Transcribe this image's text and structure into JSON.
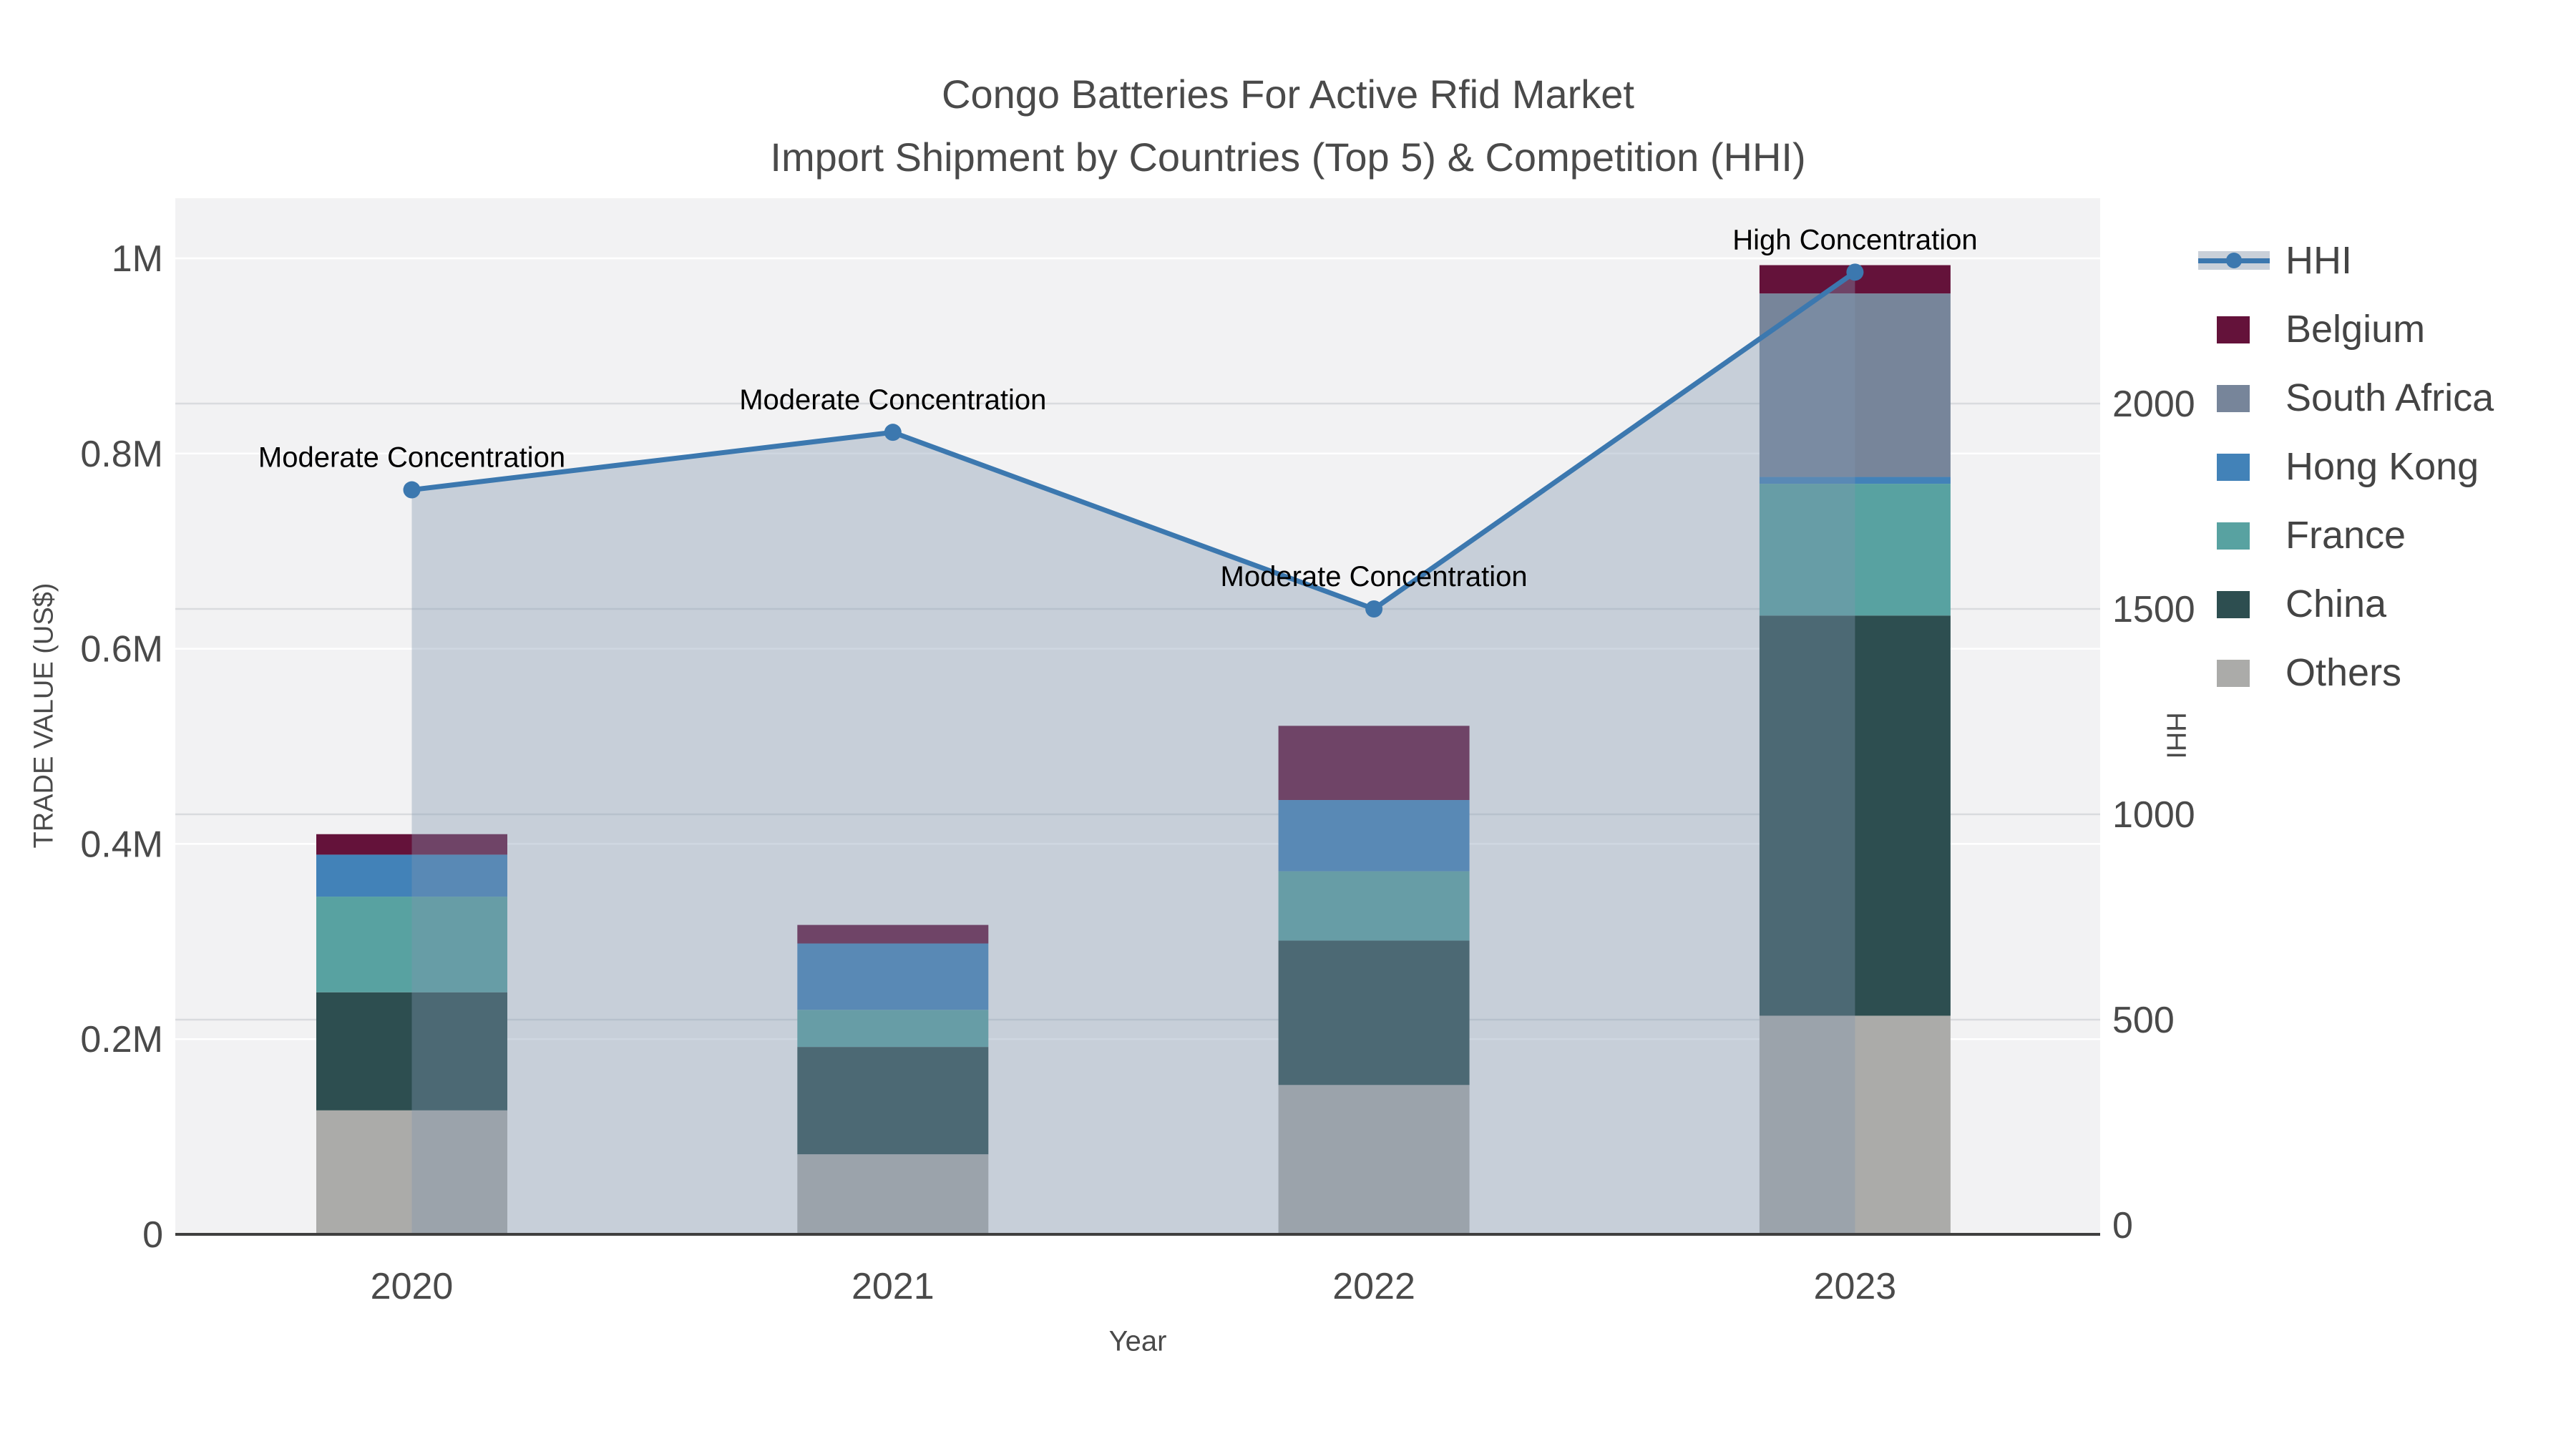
{
  "title": {
    "line1": "Congo Batteries For Active Rfid Market",
    "line2": "Import Shipment by Countries (Top 5) & Competition (HHI)"
  },
  "chart_data": {
    "type": "bar",
    "subtype": "stacked bars with secondary-axis line+area",
    "categories": [
      "2020",
      "2021",
      "2022",
      "2023"
    ],
    "series": [
      {
        "name": "Others",
        "color": "#abab a9",
        "values": [
          127000,
          82000,
          153000,
          224000
        ]
      },
      {
        "name": "China",
        "color": "#2d4e50",
        "values": [
          121000,
          110000,
          148000,
          410000
        ]
      },
      {
        "name": "France",
        "color": "#58a2a1",
        "values": [
          98000,
          38000,
          71000,
          135000
        ]
      },
      {
        "name": "Hong Kong",
        "color": "#4282b8",
        "values": [
          43000,
          68000,
          73000,
          7000
        ]
      },
      {
        "name": "South Africa",
        "color": "#77859a",
        "values": [
          0,
          0,
          0,
          188000
        ]
      },
      {
        "name": "Belgium",
        "color": "#64123a",
        "values": [
          21000,
          19000,
          76000,
          29000
        ]
      }
    ],
    "line": {
      "name": "HHI",
      "color": "#3c78af",
      "area_fill": "rgba(130,150,175,0.38)",
      "values": [
        1790,
        1930,
        1500,
        2320
      ]
    },
    "annotations": [
      {
        "category": "2020",
        "text": "Moderate Concentration"
      },
      {
        "category": "2021",
        "text": "Moderate Concentration"
      },
      {
        "category": "2022",
        "text": "Moderate Concentration"
      },
      {
        "category": "2023",
        "text": "High Concentration"
      }
    ],
    "left_axis": {
      "label": "TRADE VALUE (US$)",
      "ticks": [
        "0",
        "0.2M",
        "0.4M",
        "0.6M",
        "0.8M",
        "1M"
      ],
      "tick_values": [
        0,
        200000,
        400000,
        600000,
        800000,
        1000000
      ],
      "range": [
        0,
        1062000
      ]
    },
    "right_axis": {
      "label": "HHI",
      "ticks": [
        "0",
        "500",
        "1000",
        "1500",
        "2000"
      ],
      "tick_values": [
        0,
        500,
        1000,
        1500,
        2000
      ],
      "range": [
        0,
        2500
      ]
    },
    "x_axis_label": "Year",
    "legend": {
      "position": "right",
      "items": [
        "HHI",
        "Belgium",
        "South Africa",
        "Hong Kong",
        "France",
        "China",
        "Others"
      ]
    },
    "plot_background": "#f2f2f3",
    "grid": true
  }
}
